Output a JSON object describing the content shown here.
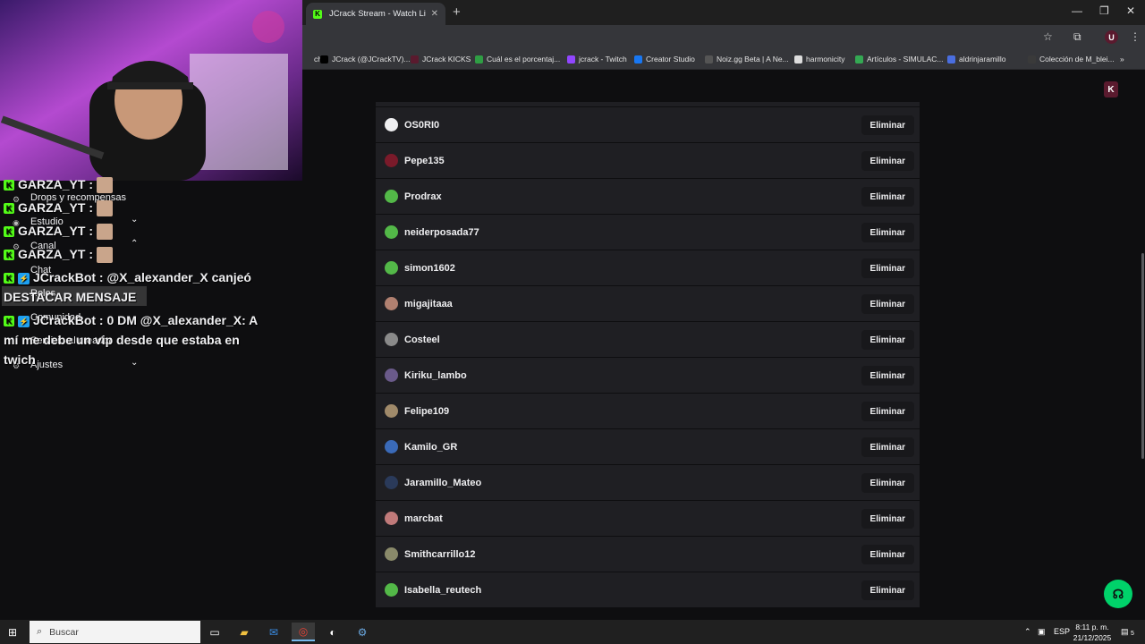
{
  "browser": {
    "active_tab_title": "JCrack Stream - Watch Live on Kick",
    "new_tab_symbol": "+",
    "profile_initial": "U",
    "bookmarks": [
      {
        "label": "ch",
        "color": "#35363a"
      },
      {
        "label": "JCrack (@JCrackTV)...",
        "color": "#000000"
      },
      {
        "label": "JCrack KICKS",
        "color": "#5a1a2e"
      },
      {
        "label": "Cuál es el porcentaj...",
        "color": "#2f9e44"
      },
      {
        "label": "jcrack - Twitch",
        "color": "#9146ff"
      },
      {
        "label": "Creator Studio",
        "color": "#1877f2"
      },
      {
        "label": "Noiz.gg Beta | A Ne...",
        "color": "#555555"
      },
      {
        "label": "harmonicity",
        "color": "#dddddd"
      },
      {
        "label": "Artículos - SIMULAC...",
        "color": "#34a853"
      },
      {
        "label": "aldrinjaramillo",
        "color": "#4a6ee0"
      },
      {
        "label": "Colección de M_blei...",
        "color": "#3a3a3a"
      }
    ]
  },
  "page": {
    "logo_initial": "K",
    "users": [
      {
        "name": "OS0RI0",
        "action": "Eliminar",
        "avatar_color": "#efeff1"
      },
      {
        "name": "Pepe135",
        "action": "Eliminar",
        "avatar_color": "#7a1a2a"
      },
      {
        "name": "Prodrax",
        "action": "Eliminar",
        "avatar_color": "#53b848"
      },
      {
        "name": "neiderposada77",
        "action": "Eliminar",
        "avatar_color": "#53b848"
      },
      {
        "name": "simon1602",
        "action": "Eliminar",
        "avatar_color": "#53b848"
      },
      {
        "name": "migajitaaa",
        "action": "Eliminar",
        "avatar_color": "#b08070"
      },
      {
        "name": "Costeel",
        "action": "Eliminar",
        "avatar_color": "#8a8a8a"
      },
      {
        "name": "Kiriku_lambo",
        "action": "Eliminar",
        "avatar_color": "#6a5a8a"
      },
      {
        "name": "Felipe109",
        "action": "Eliminar",
        "avatar_color": "#a08a6a"
      },
      {
        "name": "Kamilo_GR",
        "action": "Eliminar",
        "avatar_color": "#3a6ab8"
      },
      {
        "name": "Jaramillo_Mateo",
        "action": "Eliminar",
        "avatar_color": "#2a3a5a"
      },
      {
        "name": "marcbat",
        "action": "Eliminar",
        "avatar_color": "#c07a7a"
      },
      {
        "name": "Smithcarrillo12",
        "action": "Eliminar",
        "avatar_color": "#8a8a6a"
      },
      {
        "name": "Isabella_reutech",
        "action": "Eliminar",
        "avatar_color": "#53b848"
      }
    ]
  },
  "overlay": {
    "chat": [
      {
        "user": "GARZA_YT",
        "sep": " :"
      },
      {
        "user": "GARZA_YT",
        "sep": " :"
      },
      {
        "user": "GARZA_YT",
        "sep": " :"
      },
      {
        "user": "GARZA_YT",
        "sep": " :"
      }
    ],
    "bot_line1_user": "JCrackBot",
    "bot_line1_text": " : @X_alexander_X canjeó",
    "bot_line1_cont": "DESTACAR MENSAJE",
    "bot_line2_user": "JCrackBot",
    "bot_line2_text": " : 0 DM @X_alexander_X: A",
    "bot_line2_cont1": "mí me debe un vip desde que estaba en",
    "bot_line2_cont2": "twich",
    "menu": [
      {
        "label": "Drops y recompensas",
        "chevron": ""
      },
      {
        "label": "Estudio",
        "chevron": "⌄"
      },
      {
        "label": "Canal",
        "chevron": "⌃"
      },
      {
        "label": "Chat",
        "chevron": ""
      },
      {
        "label": "Roles",
        "chevron": ""
      },
      {
        "label": "Comunidad",
        "chevron": ""
      },
      {
        "label": "Servicio al creador",
        "chevron": ""
      },
      {
        "label": "Ajustes",
        "chevron": "⌄"
      }
    ]
  },
  "taskbar": {
    "search_placeholder": "Buscar",
    "language": "ESP",
    "time": "8:11 p. m.",
    "date": "21/12/2025",
    "notifications": "5"
  }
}
